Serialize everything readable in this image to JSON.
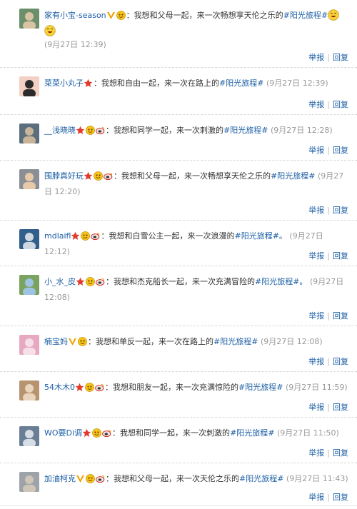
{
  "actions": {
    "report": "举报",
    "separator": "|",
    "reply": "回复"
  },
  "colors": {
    "link": "#1c5fa5",
    "time": "#999999",
    "text": "#333333",
    "vip": "#f2a000",
    "star": "#e23a2a"
  },
  "comments": [
    {
      "name": "家有小宝-season",
      "badges": [
        "vip-v-icon",
        "emoticon-icon"
      ],
      "content": "：我想和父母一起，来一次畅想享天伦之乐的",
      "topic": "#阳光旅程#",
      "time": "(9月27日 12:39)",
      "trailing_emoji": "laughing-emoji-icon"
    },
    {
      "name": "菜菜小丸子",
      "badges": [
        "star-icon"
      ],
      "content": "：我想和自由一起，来一次在路上的",
      "topic": "#阳光旅程#",
      "time": "(9月27日 12:39)"
    },
    {
      "name": "__浅晓晓",
      "badges": [
        "star-icon",
        "emoticon-icon",
        "weibo-icon"
      ],
      "content": "：我想和同学一起，来一次刺激的",
      "topic": "#阳光旅程#",
      "time": "(9月27日 12:28)"
    },
    {
      "name": "围脖真好玩",
      "badges": [
        "star-icon",
        "emoticon-icon",
        "weibo-icon"
      ],
      "content": "：我想和父母一起，来一次畅想享天伦之乐的",
      "topic": "#阳光旅程#",
      "time": "(9月27日 12:20)"
    },
    {
      "name": "mdlaifl",
      "badges": [
        "star-icon",
        "emoticon-icon",
        "weibo-icon"
      ],
      "content": "：我想和白雪公主一起，来一次浪漫的",
      "topic": "#阳光旅程#。",
      "time": "(9月27日 12:12)"
    },
    {
      "name": "小_水_皮",
      "badges": [
        "star-icon",
        "emoticon-icon",
        "weibo-icon"
      ],
      "content": "：我想和杰克船长一起，来一次充满冒险的",
      "topic": "#阳光旅程#。",
      "time": "(9月27日 12:08)"
    },
    {
      "name": "楠宝妈",
      "badges": [
        "vip-v-icon",
        "emoticon-icon"
      ],
      "content": "：我想和单反一起，来一次在路上的",
      "topic": "#阳光旅程#",
      "time": "(9月27日 12:08)"
    },
    {
      "name": "54木木0",
      "badges": [
        "star-icon",
        "emoticon-icon",
        "weibo-icon"
      ],
      "content": "：我想和朋友一起，来一次充满惊险的",
      "topic": "#阳光旅程#",
      "time": "(9月27日 11:59)"
    },
    {
      "name": "WO要Di调",
      "badges": [
        "star-icon",
        "emoticon-icon",
        "weibo-icon"
      ],
      "content": "：我想和同学一起，来一次刺激的",
      "topic": "#阳光旅程#",
      "time": "(9月27日 11:50)"
    },
    {
      "name": "加油柯克",
      "badges": [
        "vip-v-icon",
        "emoticon-icon",
        "weibo-icon"
      ],
      "content": "：我想和父母一起，来一次天伦之乐的",
      "topic": "#阳光旅程#",
      "time": "(9月27日 11:43)"
    }
  ]
}
